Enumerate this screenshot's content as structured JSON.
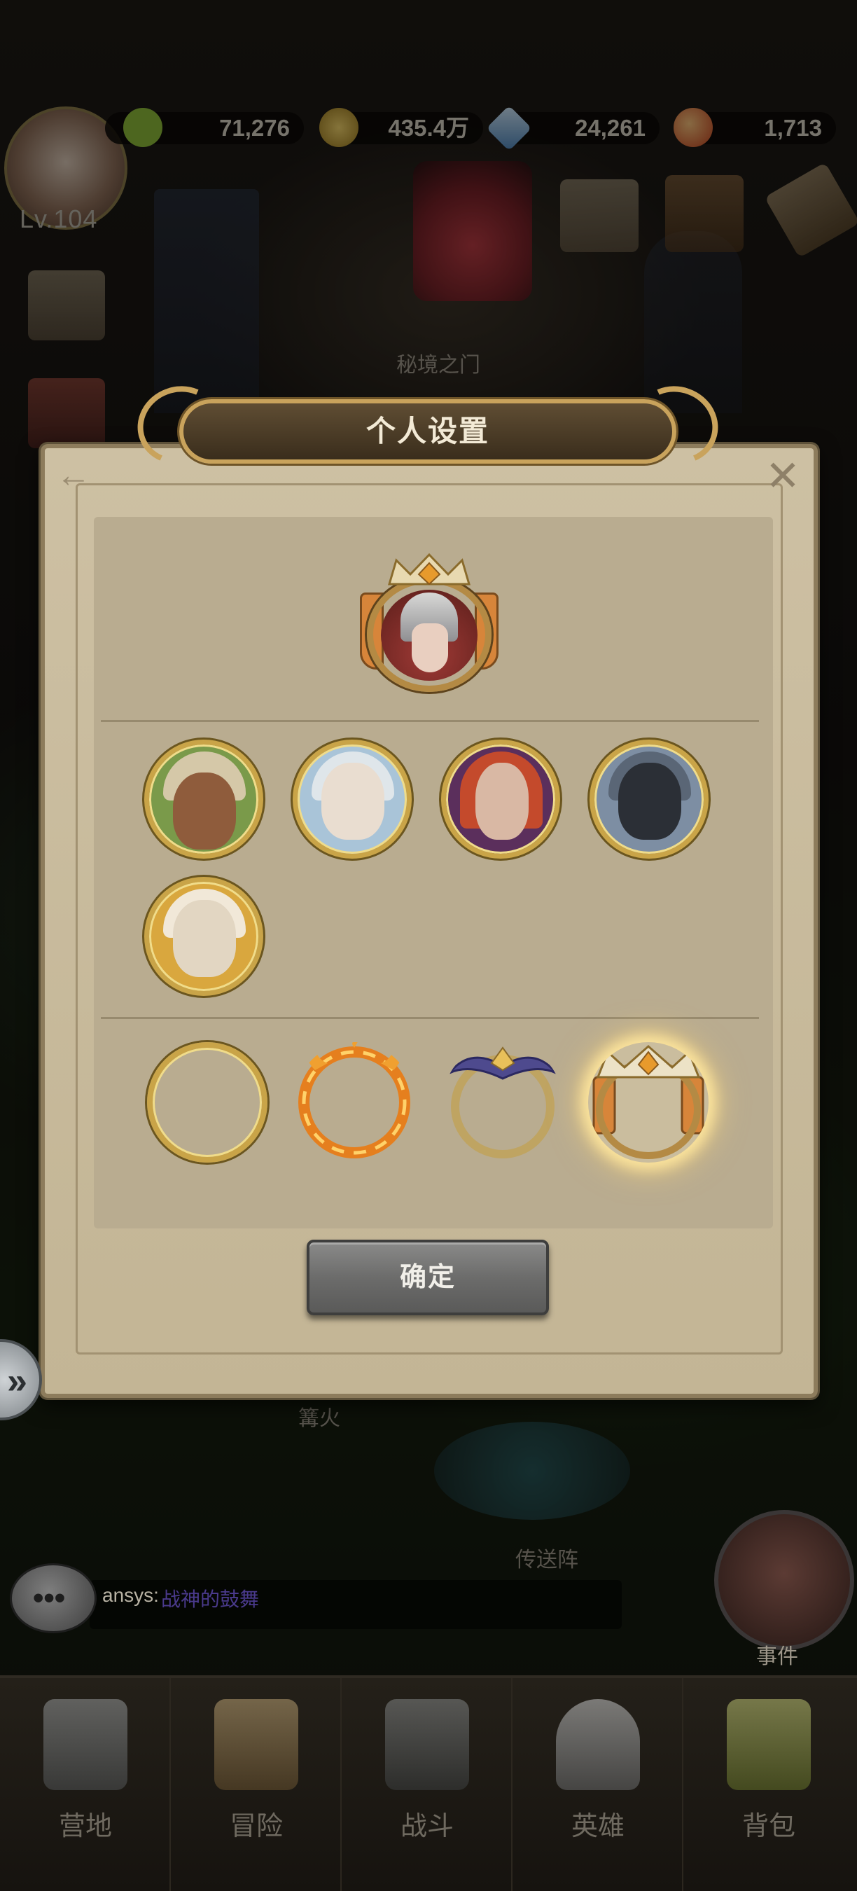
{
  "top_bar": {
    "level": "Lv.104",
    "resources": [
      {
        "value": "71,276",
        "icon": "crossed-swords-icon",
        "color": "#8dbb3a"
      },
      {
        "value": "435.4万",
        "icon": "gold-coin-icon",
        "color": "#c9a63c"
      },
      {
        "value": "24,261",
        "icon": "diamond-icon",
        "color": "#6fa7d6"
      },
      {
        "value": "1,713",
        "icon": "orb-icon",
        "color": "#d46a2a"
      }
    ]
  },
  "scene": {
    "portal_label": "秘境之门",
    "campfire_label": "篝火",
    "teleport_label": "传送阵",
    "event_label": "事件"
  },
  "dialog": {
    "title": "个人设置",
    "confirm_label": "确定",
    "avatars": [
      {
        "name": "bearded-warrior",
        "bg": "#7a9a4a"
      },
      {
        "name": "masked-priestess",
        "bg": "#a9c4d8"
      },
      {
        "name": "red-haired-sorceress",
        "bg": "#b5452f"
      },
      {
        "name": "dark-knight",
        "bg": "#7d8ea3"
      },
      {
        "name": "golden-paladin",
        "bg": "#d9a73e"
      }
    ],
    "frames": [
      {
        "name": "plain-gold-frame",
        "selected": false
      },
      {
        "name": "flame-frame",
        "selected": false
      },
      {
        "name": "winged-sapphire-frame",
        "selected": false
      },
      {
        "name": "crowned-orange-frame",
        "selected": true
      }
    ]
  },
  "chat": {
    "sender": "ansys:",
    "message": "战神的鼓舞"
  },
  "bottom_nav": {
    "items": [
      {
        "label": "营地",
        "icon": "camp-icon"
      },
      {
        "label": "冒险",
        "icon": "map-icon"
      },
      {
        "label": "战斗",
        "icon": "battle-shield-icon"
      },
      {
        "label": "英雄",
        "icon": "helmet-icon"
      },
      {
        "label": "背包",
        "icon": "bag-icon"
      }
    ]
  }
}
